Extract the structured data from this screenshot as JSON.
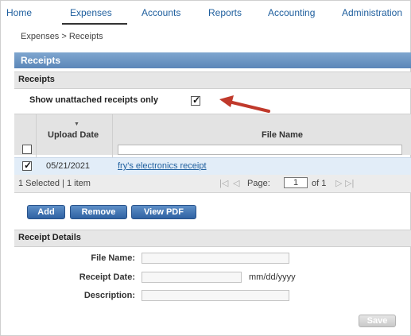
{
  "nav": {
    "tabs": [
      "Home",
      "Expenses",
      "Accounts",
      "Reports",
      "Accounting",
      "Administration"
    ],
    "active_tab": "Expenses"
  },
  "breadcrumb": "Expenses > Receipts",
  "panel_title": "Receipts",
  "section_receipts": "Receipts",
  "filter": {
    "label": "Show unattached receipts only",
    "checked": true
  },
  "grid": {
    "columns": [
      "Upload Date",
      "File Name"
    ],
    "rows": [
      {
        "upload_date": "05/21/2021",
        "file_name": "fry's electronics receipt",
        "checked": true
      }
    ]
  },
  "pager": {
    "selection": "1 Selected | 1 item",
    "page_label": "Page:",
    "page_value": "1",
    "of_text": "of 1"
  },
  "buttons": {
    "add": "Add",
    "remove": "Remove",
    "view_pdf": "View PDF",
    "save": "Save"
  },
  "details": {
    "title": "Receipt Details",
    "file_name_label": "File Name:",
    "receipt_date_label": "Receipt Date:",
    "date_hint": "mm/dd/yyyy",
    "description_label": "Description:"
  },
  "colors": {
    "accent": "#1f5f9e",
    "bar": "#5b86b8",
    "arrow": "#c0392b",
    "row_selected": "#e2edf8"
  }
}
